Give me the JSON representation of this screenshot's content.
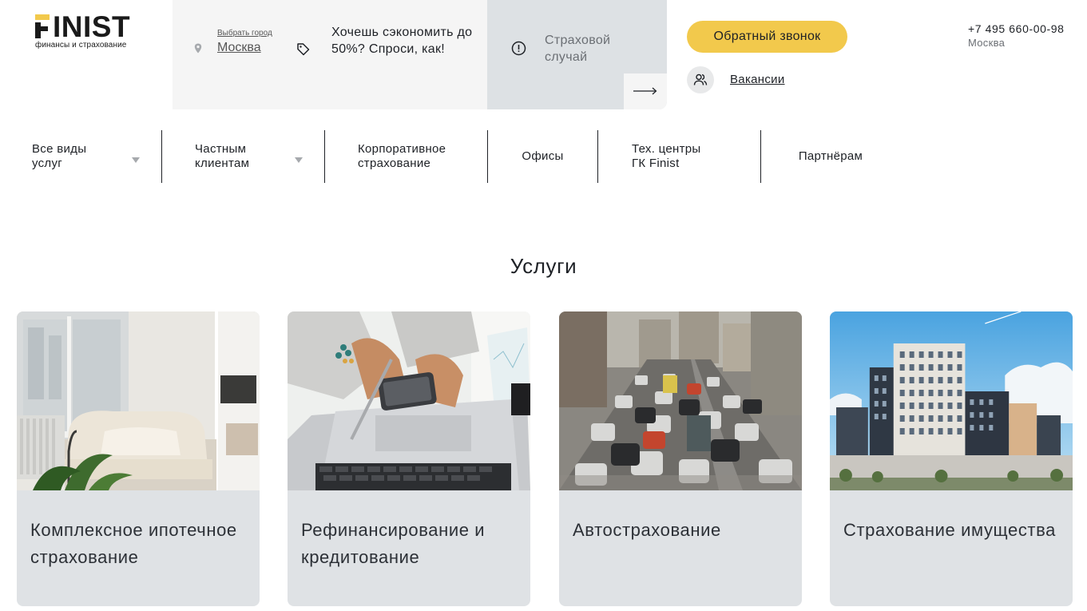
{
  "header": {
    "logo": {
      "text": "INIST",
      "subtitle": "финансы и страхование"
    },
    "city": {
      "caption": "Выбрать город",
      "name": "Москва"
    },
    "promo": "Хочешь сэкономить до 50%? Спроси, как!",
    "claim": "Страховой случай",
    "callback_button": "Обратный звонок",
    "vacancies": "Вакансии",
    "phone": "+7 495 660-00-98",
    "phone_city": "Москва"
  },
  "nav": {
    "items": [
      {
        "label_line1": "Все виды",
        "label_line2": "услуг",
        "has_dropdown": true
      },
      {
        "label_line1": "Частным",
        "label_line2": "клиентам",
        "has_dropdown": true
      },
      {
        "label_line1": "Корпоративное",
        "label_line2": "страхование",
        "has_dropdown": false
      },
      {
        "label_line1": "Офисы",
        "label_line2": "",
        "has_dropdown": false
      },
      {
        "label_line1": "Тех. центры",
        "label_line2": "ГК Finist",
        "has_dropdown": false
      },
      {
        "label_line1": "Партнёрам",
        "label_line2": "",
        "has_dropdown": false
      }
    ]
  },
  "services": {
    "title": "Услуги",
    "cards": [
      {
        "title": "Комплексное ипотечное страхование",
        "image": "interior-armchair-photo"
      },
      {
        "title": "Рефинансирование и кредитование",
        "image": "laptop-phone-hands-photo"
      },
      {
        "title": "Автострахование",
        "image": "city-traffic-photo"
      },
      {
        "title": "Страхование имущества",
        "image": "residential-buildings-photo"
      }
    ]
  },
  "colors": {
    "accent": "#f2c94c",
    "panel_light": "#f5f5f5",
    "panel_gray": "#dde1e4",
    "text": "#1e2126",
    "card_bg": "#dfe2e5"
  }
}
